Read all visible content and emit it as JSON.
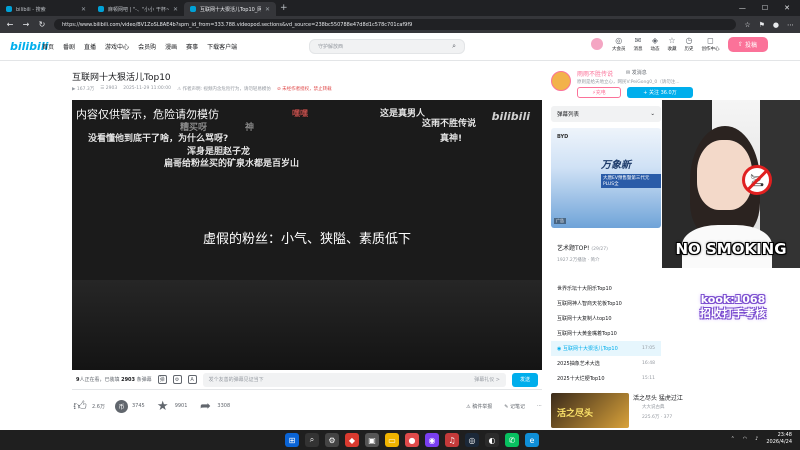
{
  "browser": {
    "tabs": [
      {
        "label": "bilibili - 搜索",
        "active": false
      },
      {
        "label": "麻顿网吧 | \"-、\"小小 干杯~-bilibili",
        "active": false
      },
      {
        "label": "互联网十大狠活儿Top10_网络...",
        "active": true
      }
    ],
    "url": "https://www.bilibili.com/video/BV1ZoSL8AE4b?spm_id_from=333.788.videopod.sections&vd_source=238bc550788e47d8d1c578c701caf9f9"
  },
  "header": {
    "logo": "bilibili",
    "nav": [
      "首页",
      "番剧",
      "直播",
      "游戏中心",
      "会员购",
      "漫画",
      "赛事",
      "下载客户端"
    ],
    "search_placeholder": "守护解放西",
    "items": [
      {
        "icon": "vip-icon",
        "label": "大会员",
        "glyph": "◎"
      },
      {
        "icon": "message-icon",
        "label": "消息",
        "glyph": "✉"
      },
      {
        "icon": "dynamic-icon",
        "label": "动态",
        "glyph": "◈"
      },
      {
        "icon": "favorite-icon",
        "label": "收藏",
        "glyph": "☆"
      },
      {
        "icon": "history-icon",
        "label": "历史",
        "glyph": "◷"
      },
      {
        "icon": "creator-icon",
        "label": "创作中心",
        "glyph": "◻"
      }
    ],
    "upload_label": "投稿"
  },
  "video": {
    "title": "互联网十大狠活儿Top10",
    "views": "167.3万",
    "danmaku_count": "2903",
    "date": "2025-11-29 11:00:00",
    "notice": "作者声明: 视频内含危险行为，请勿轻易模仿",
    "reprint": "未经作者授权，禁止转载",
    "subtitle": "虚假的粉丝：小气、狭隘、素质低下",
    "watermark": "bilibili",
    "danmaku": [
      {
        "text": "内容仅供警示，危险请勿模仿",
        "cls": "warn"
      },
      {
        "text": "这是真男人",
        "cls": ""
      },
      {
        "text": "这雨不胜传说",
        "cls": ""
      },
      {
        "text": "真神!",
        "cls": ""
      },
      {
        "text": "没看懂他到底干了啥，为什么骂呀?",
        "cls": ""
      },
      {
        "text": "浑身是胆赵子龙",
        "cls": ""
      },
      {
        "text": "扁哥给粉丝买的矿泉水都是百岁山",
        "cls": ""
      },
      {
        "text": "神",
        "cls": "dim"
      },
      {
        "text": "糟买呀",
        "cls": "dim"
      },
      {
        "text": "嘿嘿",
        "cls": "red"
      }
    ]
  },
  "danmaku_bar": {
    "watching_count": "9",
    "watching_suffix": "人正在看，已装填",
    "loaded_count": "2903",
    "loaded_suffix": "条弹幕",
    "input_placeholder": "发个友善的弹幕见证当下",
    "etiquette": "弹幕礼仪 >",
    "send_label": "发送"
  },
  "actions": {
    "like": "2.6万",
    "coin": "3745",
    "favorite": "9901",
    "share": "3308",
    "report": "稿件举报",
    "note": "记笔记"
  },
  "uploader": {
    "name": "雨雨不胜传说",
    "message": "发消息",
    "desc": "原则是给天地立心，网民V:PeiGong0_0（请勿注...",
    "charge_label": "充电",
    "follow_label": "+ 关注 36.0万"
  },
  "sidebar": {
    "danmaku_list_label": "弹幕列表",
    "ad": {
      "brand": "BYD",
      "slogan": "万象新",
      "sub": "大唐EV预售暨第三代元PLUS全",
      "tag": "广告"
    },
    "art_title": "艺术题TOP!",
    "art_count": "(29/27)",
    "art_meta": "1927.2万播放 · 简介",
    "playlist": [
      {
        "title": "世界乐坛十大阴乐Top10",
        "duration": "",
        "active": false
      },
      {
        "title": "互联网神人智商天花板Top10",
        "duration": "",
        "active": false
      },
      {
        "title": "互联网十大复制人top10",
        "duration": "",
        "active": false
      },
      {
        "title": "互联网十大黄金嘴着Top10",
        "duration": "",
        "active": false
      },
      {
        "title": "互联网十大狠活儿Top10",
        "duration": "17:05",
        "active": true
      },
      {
        "title": "2025抽象艺术大选",
        "duration": "16:48",
        "active": false
      },
      {
        "title": "2025十大烂梗Top10",
        "duration": "15:11",
        "active": false
      }
    ],
    "recommend": {
      "thumb_text": "活之尽头",
      "title": "活之尽头 猛虎过江",
      "author": "大大说古典",
      "stats": "225.6万 · 377"
    }
  },
  "overlay": {
    "no_smoking": "NO SMOKING",
    "kook_line1": "kook:1068",
    "kook_line2": "招收打手考核"
  },
  "taskbar": {
    "time": "23:48",
    "date": "2026/4/24"
  }
}
